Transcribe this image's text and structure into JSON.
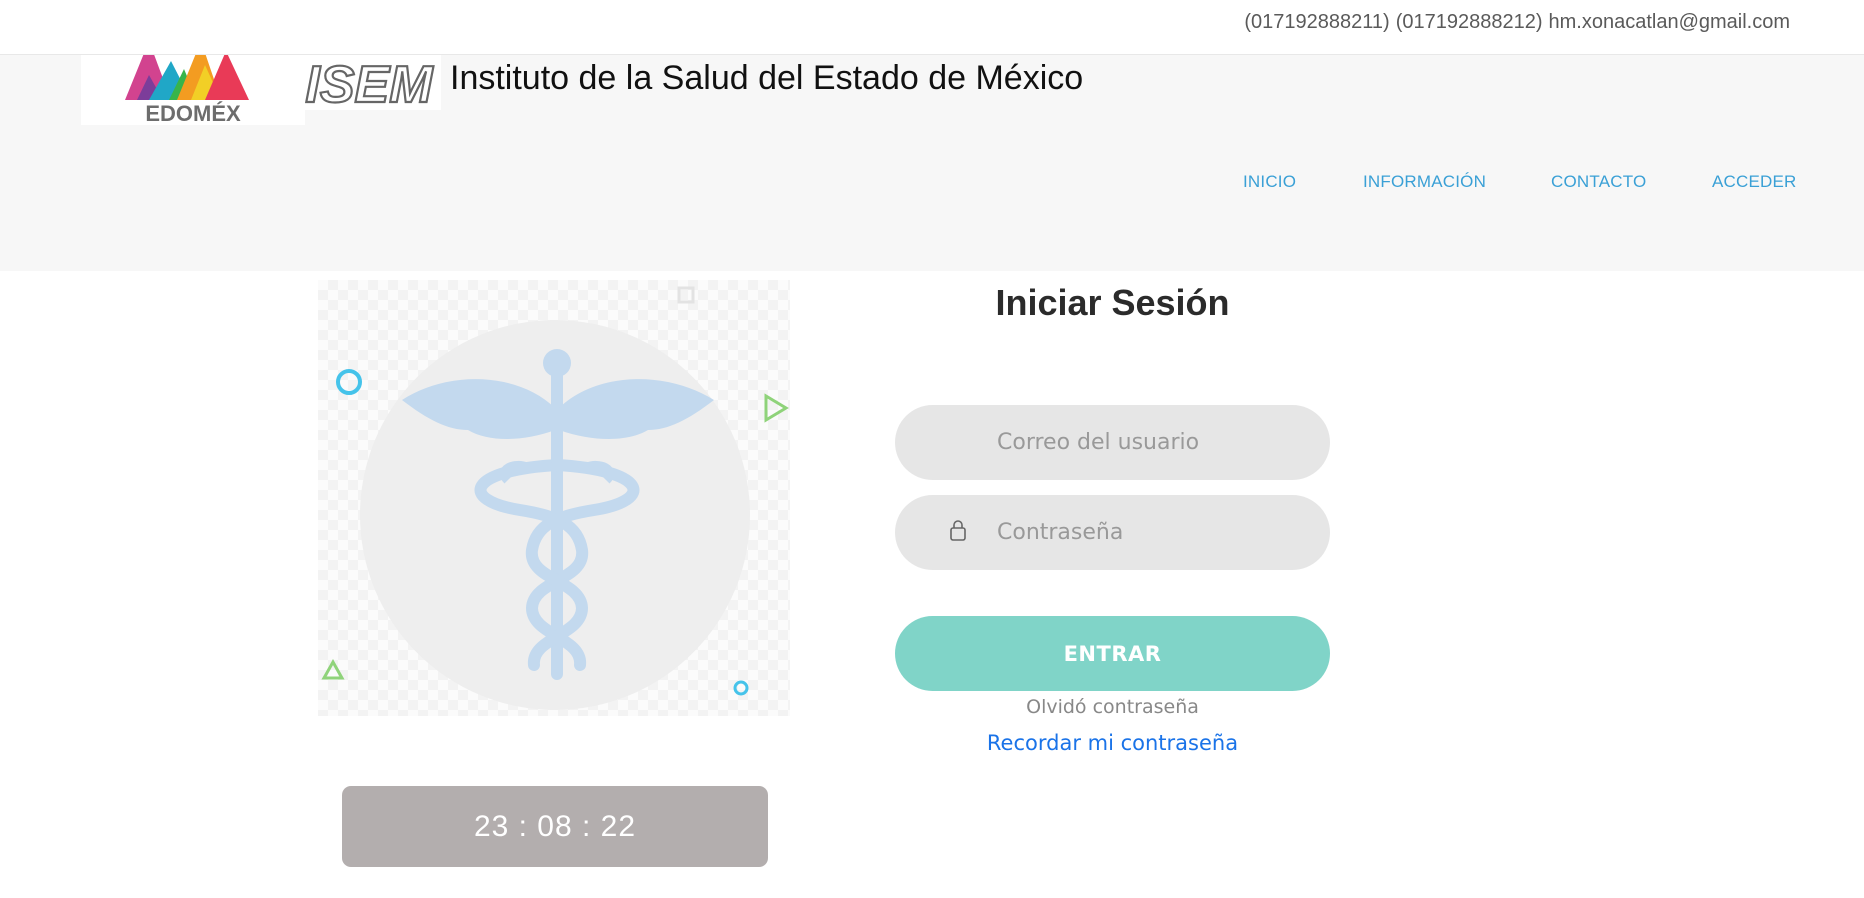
{
  "topbar": {
    "phone1": "(017192888211)",
    "phone2": "(017192888212)",
    "email": "hm.xonacatlan@gmail.com"
  },
  "header": {
    "edomex_logo_text": "EDOMÉX",
    "isem_logo_text": "ISEM",
    "title": "Instituto de la Salud del Estado de México"
  },
  "nav": {
    "inicio": "INICIO",
    "informacion": "INFORMACIÓN",
    "contacto": "CONTACTO",
    "acceder": "ACCEDER"
  },
  "illustration": {
    "icon": "caduceus-icon",
    "colors": {
      "caduceus": "#c3d9ee",
      "circle_outline": "#45c3ea",
      "triangle_outline": "#8fd37a"
    }
  },
  "login": {
    "title": "Iniciar Sesión",
    "user_placeholder": "Correo del usuario",
    "password_placeholder": "Contraseña",
    "password_icon": "lock-icon",
    "submit_label": "ENTRAR",
    "forgot_text": "Olvidó contraseña",
    "remember_link": "Recordar mi contraseña",
    "colors": {
      "button": "#80d4c8",
      "link": "#1a73e8",
      "field_bg": "#e6e6e6"
    }
  },
  "clock": {
    "time": "23 : 08 : 22",
    "bg": "#b3aeae"
  },
  "colors": {
    "nav": "#3aa0d6",
    "header_bg": "#f7f7f7"
  }
}
